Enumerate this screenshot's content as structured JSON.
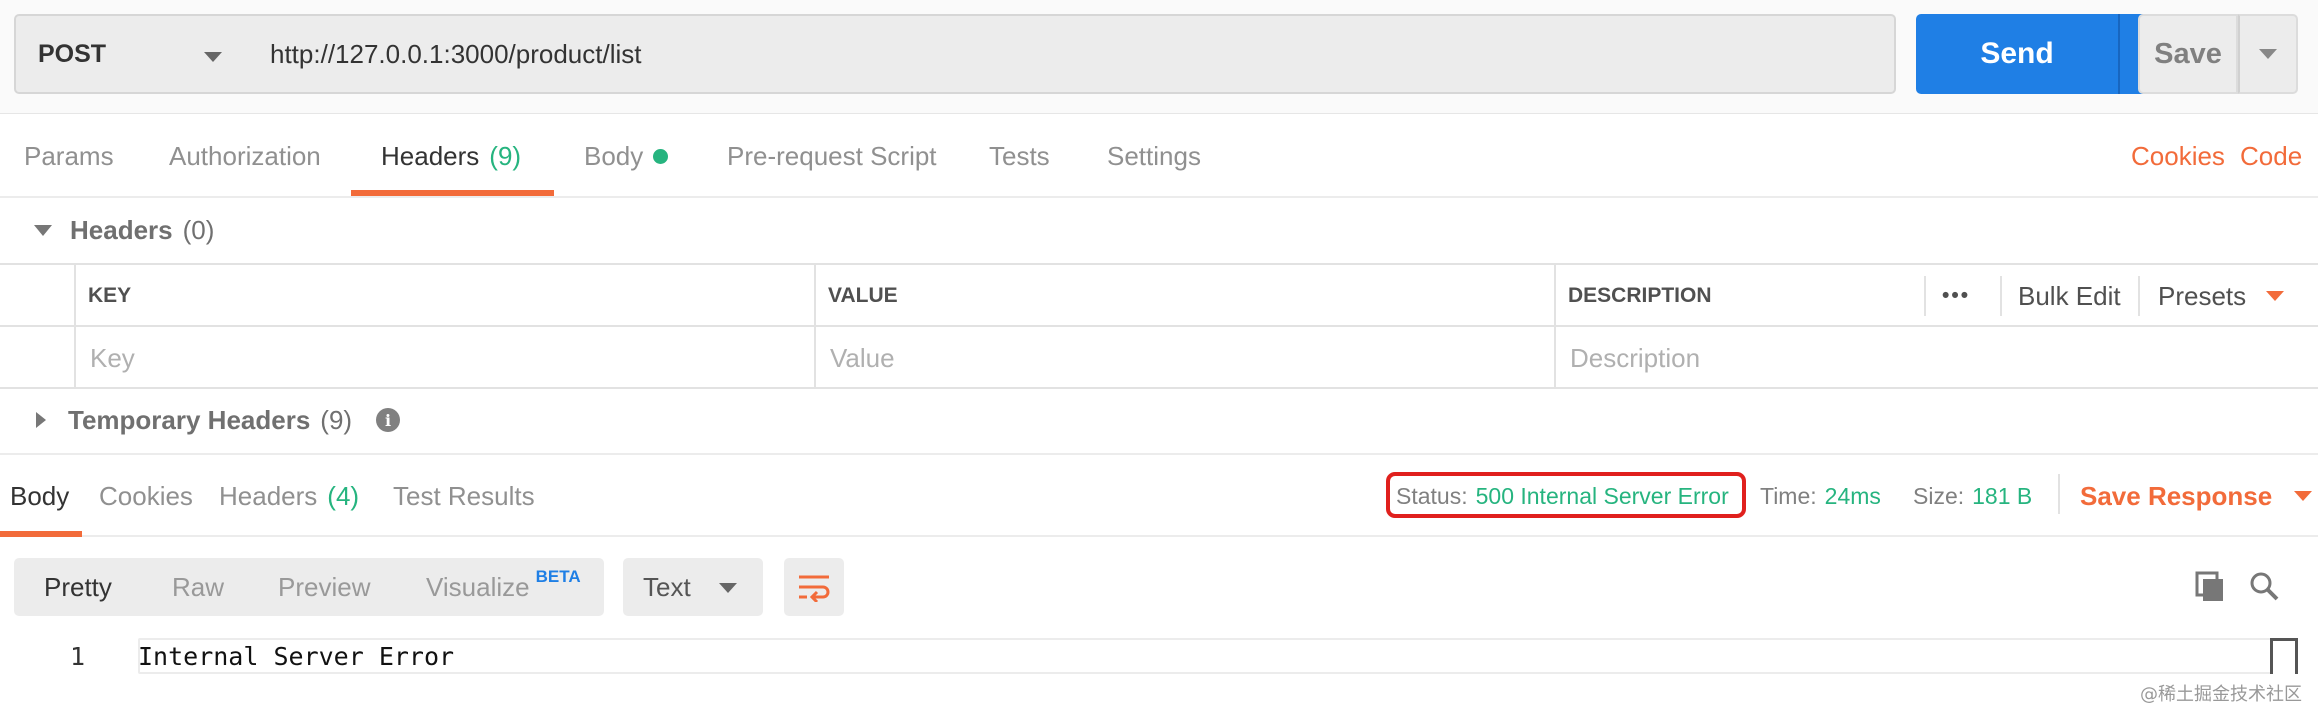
{
  "request": {
    "method": "POST",
    "url": "http://127.0.0.1:3000/product/list",
    "send_label": "Send",
    "save_label": "Save"
  },
  "request_tabs": {
    "params": "Params",
    "authorization": "Authorization",
    "headers": "Headers",
    "headers_count": "(9)",
    "body": "Body",
    "pre_request": "Pre-request Script",
    "tests": "Tests",
    "settings": "Settings",
    "cookies": "Cookies",
    "code": "Code"
  },
  "headers_section": {
    "title": "Headers",
    "count": "(0)",
    "columns": {
      "key": "KEY",
      "value": "VALUE",
      "description": "DESCRIPTION"
    },
    "more": "•••",
    "bulk_edit": "Bulk Edit",
    "presets": "Presets",
    "placeholders": {
      "key": "Key",
      "value": "Value",
      "description": "Description"
    }
  },
  "temporary_headers": {
    "title": "Temporary Headers",
    "count": "(9)",
    "info": "i"
  },
  "response": {
    "tabs": {
      "body": "Body",
      "cookies": "Cookies",
      "headers": "Headers",
      "headers_count": "(4)",
      "test_results": "Test Results"
    },
    "status_label": "Status:",
    "status_value": "500 Internal Server Error",
    "time_label": "Time:",
    "time_value": "24ms",
    "size_label": "Size:",
    "size_value": "181 B",
    "save_response": "Save Response",
    "formats": {
      "pretty": "Pretty",
      "raw": "Raw",
      "preview": "Preview",
      "visualize": "Visualize",
      "beta": "BETA"
    },
    "type": "Text",
    "lines": [
      {
        "number": "1",
        "text": "Internal Server Error"
      }
    ]
  },
  "watermark": "@稀土掘金技术社区",
  "colors": {
    "accent_orange": "#f26b3a",
    "send_blue": "#1f7fe5",
    "success_green": "#26b47f",
    "highlight_red": "#e0201d"
  }
}
